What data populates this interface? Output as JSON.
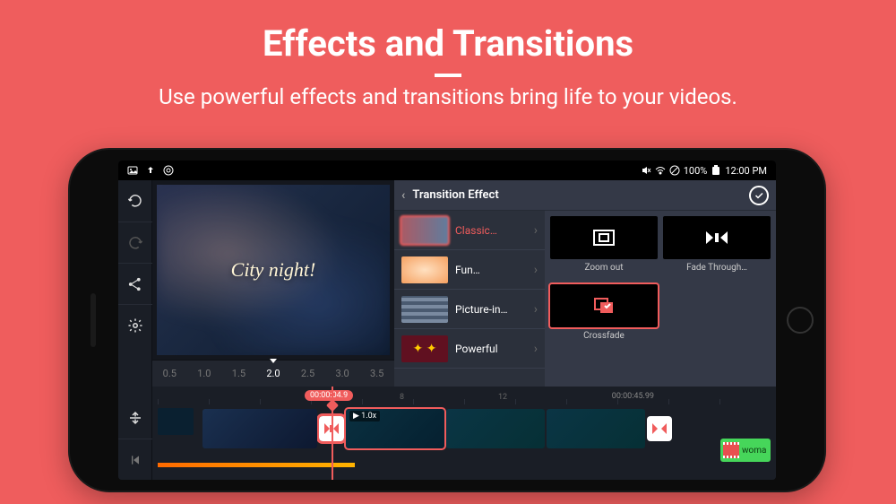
{
  "promo": {
    "title": "Effects and Transitions",
    "subtitle": "Use powerful effects and transitions bring life to your videos."
  },
  "statusbar": {
    "battery": "100%",
    "time": "12:00 PM"
  },
  "preview": {
    "caption": "City night!"
  },
  "ruler": {
    "values": [
      "0.5",
      "1.0",
      "1.5",
      "2.0",
      "2.5",
      "3.0",
      "3.5"
    ],
    "active_index": 3
  },
  "panel": {
    "title": "Transition Effect",
    "categories": [
      {
        "label": "Classic…"
      },
      {
        "label": "Fun…"
      },
      {
        "label": "Picture-in…"
      },
      {
        "label": "Powerful"
      }
    ],
    "transitions": [
      {
        "label": "Zoom out"
      },
      {
        "label": "Fade Through…"
      },
      {
        "label": "Crossfade"
      }
    ]
  },
  "timeline": {
    "current_time": "00:00:04.9",
    "end_time": "00:00:45.99",
    "marker": "8",
    "marker2": "12",
    "clip_speed": "1.0x",
    "audio_label": "woma"
  }
}
